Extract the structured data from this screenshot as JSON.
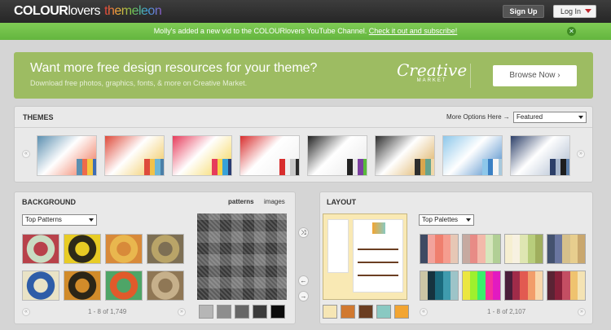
{
  "header": {
    "logo_main": "COLOUR",
    "logo_tail": "lovers",
    "logo_sub": "themeleon",
    "signup": "Sign Up",
    "login": "Log In"
  },
  "notice": {
    "text": "Molly's added a new vid to the COLOURlovers YouTube Channel.",
    "link": "Check it out and subscribe!"
  },
  "promo": {
    "title": "Want more free design resources for your theme?",
    "subtitle": "Download free photos, graphics, fonts, & more on Creative Market.",
    "brand": "Creative",
    "brand_sub": "MARKET",
    "cta": "Browse Now"
  },
  "themes": {
    "title": "THEMES",
    "more": "More Options Here →",
    "filter": "Featured",
    "items": [
      {
        "colors": [
          "#5b8fb0",
          "#ee6a4b",
          "#f4c842",
          "#3e6db5"
        ]
      },
      {
        "colors": [
          "#de4b3b",
          "#f0c24a",
          "#6cb6d7",
          "#4a7fa8"
        ]
      },
      {
        "colors": [
          "#e63c5b",
          "#f5d24a",
          "#39a2d8",
          "#2a3d73"
        ]
      },
      {
        "colors": [
          "#d82d2d",
          "#f0f0f0",
          "#c8c8c8",
          "#2b2b2b"
        ]
      },
      {
        "colors": [
          "#222222",
          "#e8e8e8",
          "#7b3fa0",
          "#59bb3b"
        ]
      },
      {
        "colors": [
          "#2d2d2d",
          "#d9a64e",
          "#66a38e",
          "#efd7a8"
        ]
      },
      {
        "colors": [
          "#8dc7ea",
          "#3a80c4",
          "#f5f5f5",
          "#a8c9dd"
        ]
      },
      {
        "colors": [
          "#2c3f68",
          "#a8b7cc",
          "#1d1d1d",
          "#5d7fa9"
        ]
      }
    ]
  },
  "background": {
    "title": "BACKGROUND",
    "tab_patterns": "patterns",
    "tab_images": "images",
    "filter": "Top Patterns",
    "count": "1 - 8 of 1,749",
    "patterns": [
      {
        "c1": "#c9dcc2",
        "c2": "#b8414a"
      },
      {
        "c1": "#2d2a18",
        "c2": "#e8cc24"
      },
      {
        "c1": "#e9b74e",
        "c2": "#d88a3a"
      },
      {
        "c1": "#b9a468",
        "c2": "#7d6f54"
      },
      {
        "c1": "#2e5da8",
        "c2": "#e9e3c6"
      },
      {
        "c1": "#2b2517",
        "c2": "#d18b2a"
      },
      {
        "c1": "#e15a2b",
        "c2": "#4ea567"
      },
      {
        "c1": "#c6b08b",
        "c2": "#8f7755"
      }
    ],
    "grays": [
      "#b6b6b6",
      "#8e8e8e",
      "#676767",
      "#3b3b3b",
      "#0b0b0b"
    ]
  },
  "layout": {
    "title": "LAYOUT",
    "filter": "Top Palettes",
    "count": "1 - 8 of 2,107",
    "preview_colors": [
      "#f6e6b5",
      "#d17930",
      "#6b3e22",
      "#89c9c2",
      "#f2a532"
    ],
    "palettes": [
      [
        "#3e4a63",
        "#f2a39c",
        "#ef7f6e",
        "#f59d8f",
        "#e7c7b5"
      ],
      [
        "#c6a9a0",
        "#e88b86",
        "#f3b9aa",
        "#d6e7bd",
        "#b1cf95"
      ],
      [
        "#f6efd1",
        "#f7f1e1",
        "#dfe6b2",
        "#b8cd7c",
        "#a0ae5e"
      ],
      [
        "#44526f",
        "#6a76a0",
        "#d6c08b",
        "#e7ce8e",
        "#c9a76e"
      ],
      [
        "#cbc6a5",
        "#16333f",
        "#1a6a7d",
        "#3f9bae",
        "#9dc4c8"
      ],
      [
        "#ebe640",
        "#9ef02e",
        "#39f06c",
        "#f5309e",
        "#e21ac1"
      ],
      [
        "#4a1e3a",
        "#a02b49",
        "#e25a51",
        "#f29d6a",
        "#f8d7ac"
      ],
      [
        "#5a2334",
        "#87203a",
        "#c44e63",
        "#efc36f",
        "#f4e3b4"
      ]
    ]
  }
}
